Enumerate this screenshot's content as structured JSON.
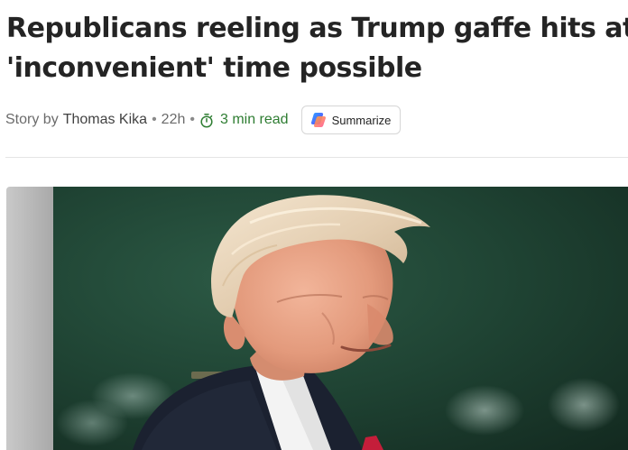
{
  "article": {
    "headline_line1": "Republicans reeling as Trump gaffe hits at most",
    "headline_line2": "'inconvenient' time possible",
    "byline": {
      "prefix": "Story by",
      "author": "Thomas Kika",
      "time_ago": "22h",
      "read_time": "3 min read",
      "separator": "•"
    },
    "summarize_label": "Summarize",
    "hero_image": {
      "subject": "photo of Donald Trump smiling in a dark suit against a dark green background"
    }
  },
  "colors": {
    "read_time": "#2e7d32",
    "headline": "#242424",
    "image_background": "#1d3a2c"
  }
}
